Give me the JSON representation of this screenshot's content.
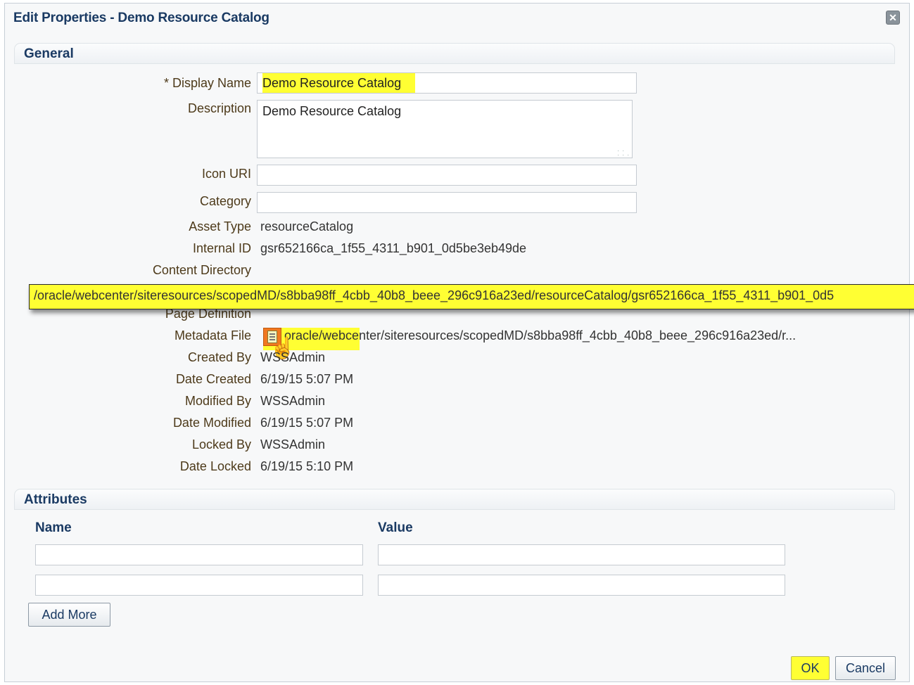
{
  "dialog": {
    "title": "Edit Properties - Demo Resource Catalog",
    "close_icon": "close-icon"
  },
  "general": {
    "header": "General",
    "display_name": {
      "label": "* Display Name",
      "value": "Demo Resource Catalog"
    },
    "description": {
      "label": "Description",
      "value": "Demo Resource Catalog"
    },
    "icon_uri": {
      "label": "Icon URI",
      "value": ""
    },
    "category": {
      "label": "Category",
      "value": ""
    },
    "asset_type": {
      "label": "Asset Type",
      "value": "resourceCatalog"
    },
    "internal_id": {
      "label": "Internal ID",
      "value": "gsr652166ca_1f55_4311_b901_0d5be3eb49de"
    },
    "content_directory": {
      "label": "Content Directory"
    },
    "page_definition": {
      "label": "Page Definition"
    },
    "metadata_file": {
      "label": "Metadata File",
      "value": "oracle/webcenter/siteresources/scopedMD/s8bba98ff_4cbb_40b8_beee_296c916a23ed/r...",
      "icon": "file-icon"
    },
    "tooltip": "/oracle/webcenter/siteresources/scopedMD/s8bba98ff_4cbb_40b8_beee_296c916a23ed/resourceCatalog/gsr652166ca_1f55_4311_b901_0d5",
    "created_by": {
      "label": "Created By",
      "value": "WSSAdmin"
    },
    "date_created": {
      "label": "Date Created",
      "value": "6/19/15 5:07 PM"
    },
    "modified_by": {
      "label": "Modified By",
      "value": "WSSAdmin"
    },
    "date_modified": {
      "label": "Date Modified",
      "value": "6/19/15 5:07 PM"
    },
    "locked_by": {
      "label": "Locked By",
      "value": "WSSAdmin"
    },
    "date_locked": {
      "label": "Date Locked",
      "value": "6/19/15 5:10 PM"
    }
  },
  "attributes": {
    "header": "Attributes",
    "name_col": "Name",
    "value_col": "Value",
    "rows": [
      {
        "name": "",
        "value": ""
      },
      {
        "name": "",
        "value": ""
      }
    ],
    "add_more": "Add More"
  },
  "footer": {
    "ok": "OK",
    "cancel": "Cancel"
  },
  "colors": {
    "highlight": "#ffff33",
    "title": "#1a3a63",
    "label": "#4d3a1a"
  }
}
